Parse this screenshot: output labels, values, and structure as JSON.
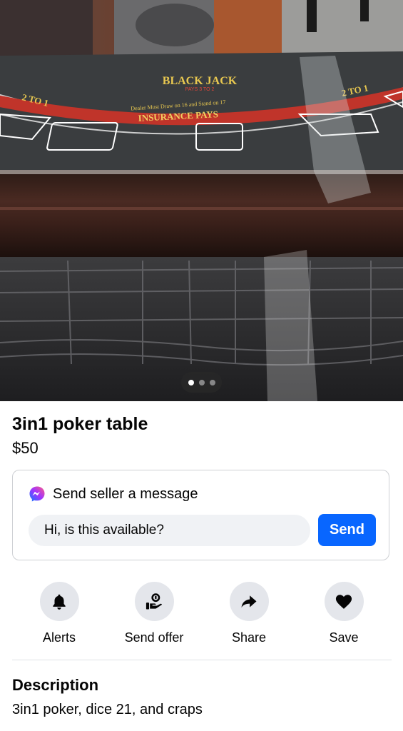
{
  "listing": {
    "photo": {
      "table_text": "BLACK JACK",
      "table_subtext": "PAYS 3 TO 2",
      "arc_text": "Dealer Must Draw on 16 and Stand on 17",
      "insurance_text": "INSURANCE PAYS",
      "ratio_left": "2 TO 1",
      "ratio_right": "2 TO 1",
      "carousel_total": 3,
      "carousel_active": 1
    },
    "title": "3in1 poker table",
    "price": "$50"
  },
  "message_card": {
    "heading": "Send seller a message",
    "input_value": "Hi, is this available?",
    "send_label": "Send"
  },
  "actions": [
    {
      "label": "Alerts",
      "icon": "bell-icon"
    },
    {
      "label": "Send offer",
      "icon": "offer-icon"
    },
    {
      "label": "Share",
      "icon": "share-arrow-icon"
    },
    {
      "label": "Save",
      "icon": "heart-icon"
    }
  ],
  "description": {
    "heading": "Description",
    "text": "3in1 poker, dice 21, and craps"
  },
  "colors": {
    "accent": "#0866ff",
    "felt": "#3a3d3f",
    "button_bg": "#e4e6eb",
    "input_bg": "#f0f2f5"
  }
}
